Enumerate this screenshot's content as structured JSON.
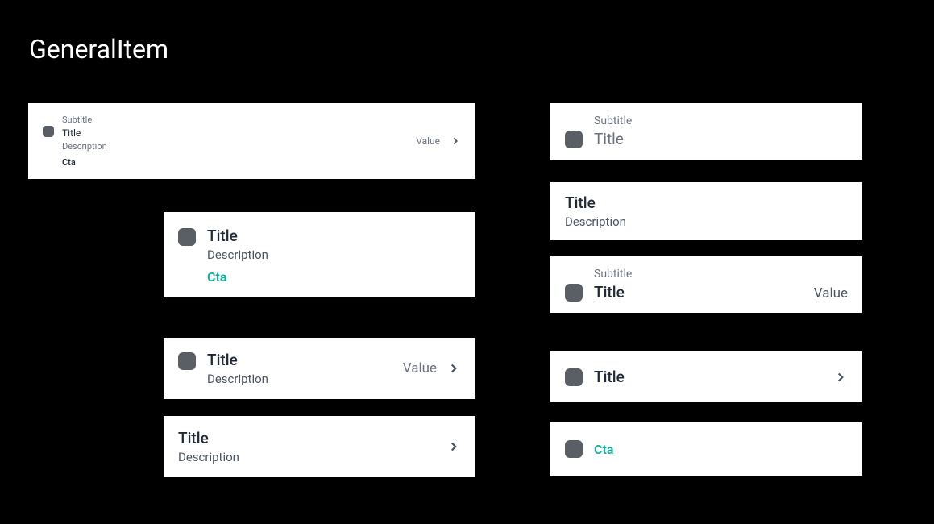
{
  "page": {
    "title": "GeneralItem"
  },
  "cards": [
    {
      "subtitle": "Subtitle",
      "title": "Title",
      "description": "Description",
      "cta": "Cta",
      "value": "Value",
      "hasIcon": true,
      "hasChevron": true
    },
    {
      "title": "Title",
      "description": "Description",
      "cta": "Cta",
      "hasIcon": true
    },
    {
      "title": "Title",
      "description": "Description",
      "value": "Value",
      "hasIcon": true,
      "hasChevron": true
    },
    {
      "title": "Title",
      "description": "Description",
      "hasChevron": true
    },
    {
      "subtitle": "Subtitle",
      "title": "Title",
      "hasIcon": true
    },
    {
      "title": "Title",
      "description": "Description"
    },
    {
      "subtitle": "Subtitle",
      "title": "Title",
      "value": "Value",
      "hasIcon": true
    },
    {
      "title": "Title",
      "hasIcon": true,
      "hasChevron": true
    },
    {
      "cta": "Cta",
      "hasIcon": true
    }
  ]
}
